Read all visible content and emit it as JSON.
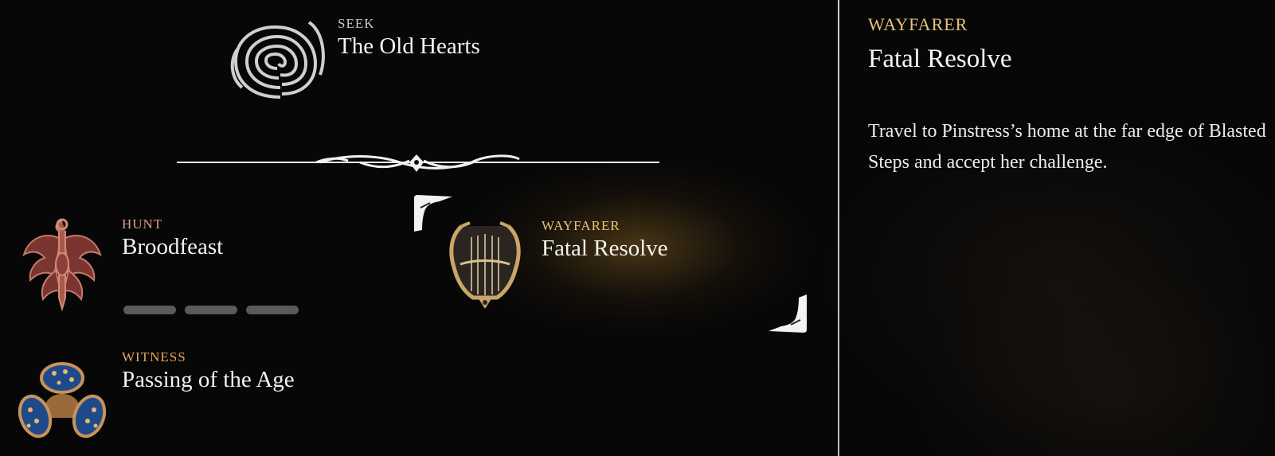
{
  "colors": {
    "seek": "#c8c8c8",
    "hunt": "#e09a8e",
    "witness": "#e7a55a",
    "wayfarer": "#e6c47a"
  },
  "quests": {
    "seek": {
      "category": "SEEK",
      "title": "The Old Hearts",
      "icon": "spiral-heart-icon"
    },
    "hunt": {
      "category": "HUNT",
      "title": "Broodfeast",
      "icon": "hunt-crest-icon",
      "progress_filled": 0,
      "progress_total": 3
    },
    "witness": {
      "category": "WITNESS",
      "title": "Passing of the Age",
      "icon": "spotted-eggs-icon"
    },
    "wayfarer": {
      "category": "WAYFARER",
      "title": "Fatal Resolve",
      "icon": "lyre-icon"
    }
  },
  "detail": {
    "category": "WAYFARER",
    "title": "Fatal Resolve",
    "description": "Travel to Pinstress’s home at the far edge of Blasted Steps and accept her challenge."
  }
}
